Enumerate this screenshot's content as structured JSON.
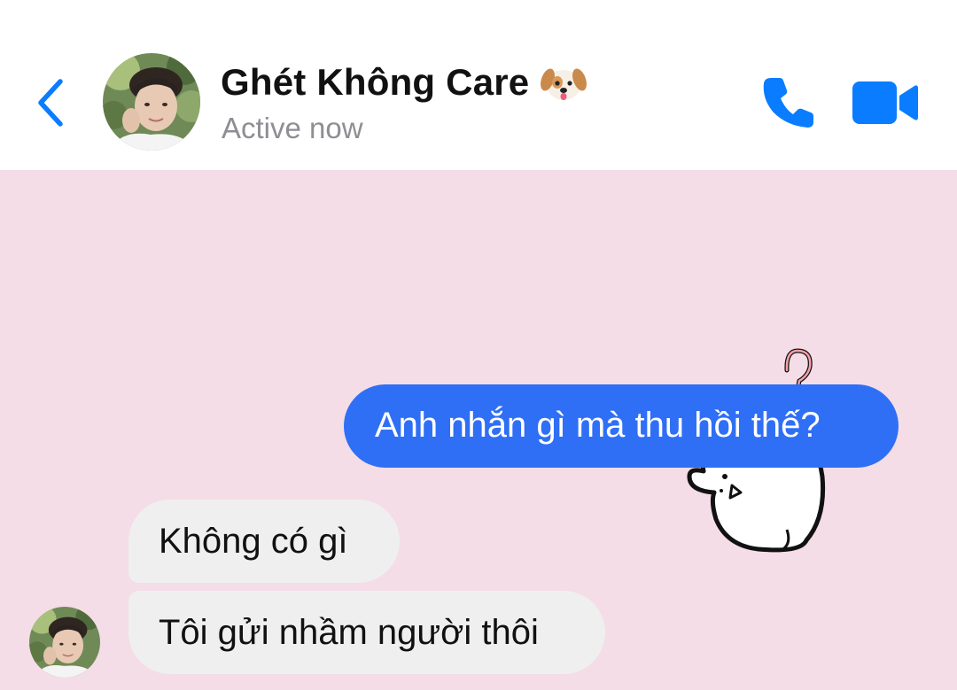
{
  "header": {
    "back_icon": "chevron-left-icon",
    "contact_name": "Ghét Không Care",
    "name_emoji_icon": "dog-face-icon",
    "status": "Active now",
    "call_icon": "phone-icon",
    "video_icon": "video-camera-icon",
    "accent_color": "#0a7cff"
  },
  "chat": {
    "background_color": "#f4dde7",
    "sticker_icon": "confused-bunny-sticker-icon",
    "messages": [
      {
        "direction": "outgoing",
        "text": "Anh nhắn gì mà thu hồi thế?",
        "color": "#2f6ff5"
      },
      {
        "direction": "incoming",
        "text": "Không có gì",
        "color": "#efefef"
      },
      {
        "direction": "incoming",
        "text": "Tôi gửi nhầm người thôi",
        "color": "#efefef"
      }
    ]
  }
}
